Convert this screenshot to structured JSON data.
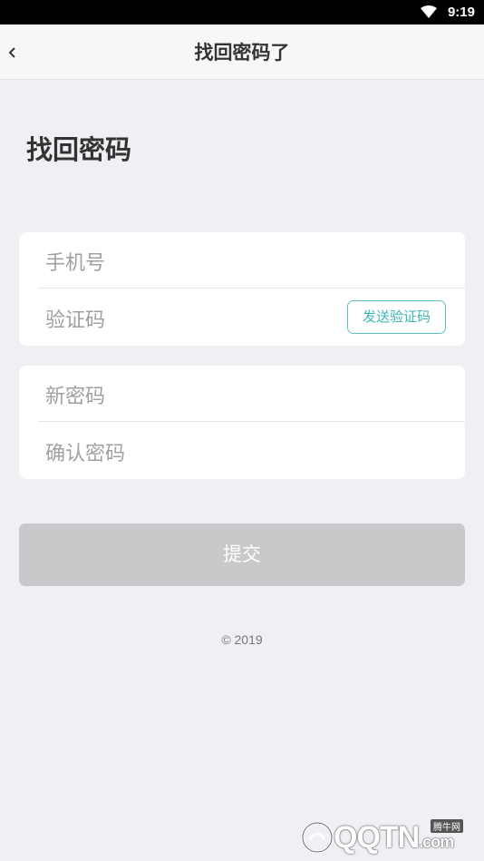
{
  "status_bar": {
    "time": "9:19",
    "wifi_icon": "wifi-icon"
  },
  "nav": {
    "title": "找回密码了",
    "back_icon": "chevron-left-icon"
  },
  "page": {
    "heading": "找回密码"
  },
  "form": {
    "phone_placeholder": "手机号",
    "code_placeholder": "验证码",
    "send_code_label": "发送验证码",
    "new_password_placeholder": "新密码",
    "confirm_password_placeholder": "确认密码",
    "submit_label": "提交"
  },
  "footer": {
    "copyright": "© 2019"
  },
  "watermark": {
    "text": "QQTN",
    "site": "腾牛网",
    "suffix": ".com"
  },
  "colors": {
    "background": "#efeff4",
    "accent": "#3fb6b2",
    "submit_disabled": "#c8c9cb"
  }
}
